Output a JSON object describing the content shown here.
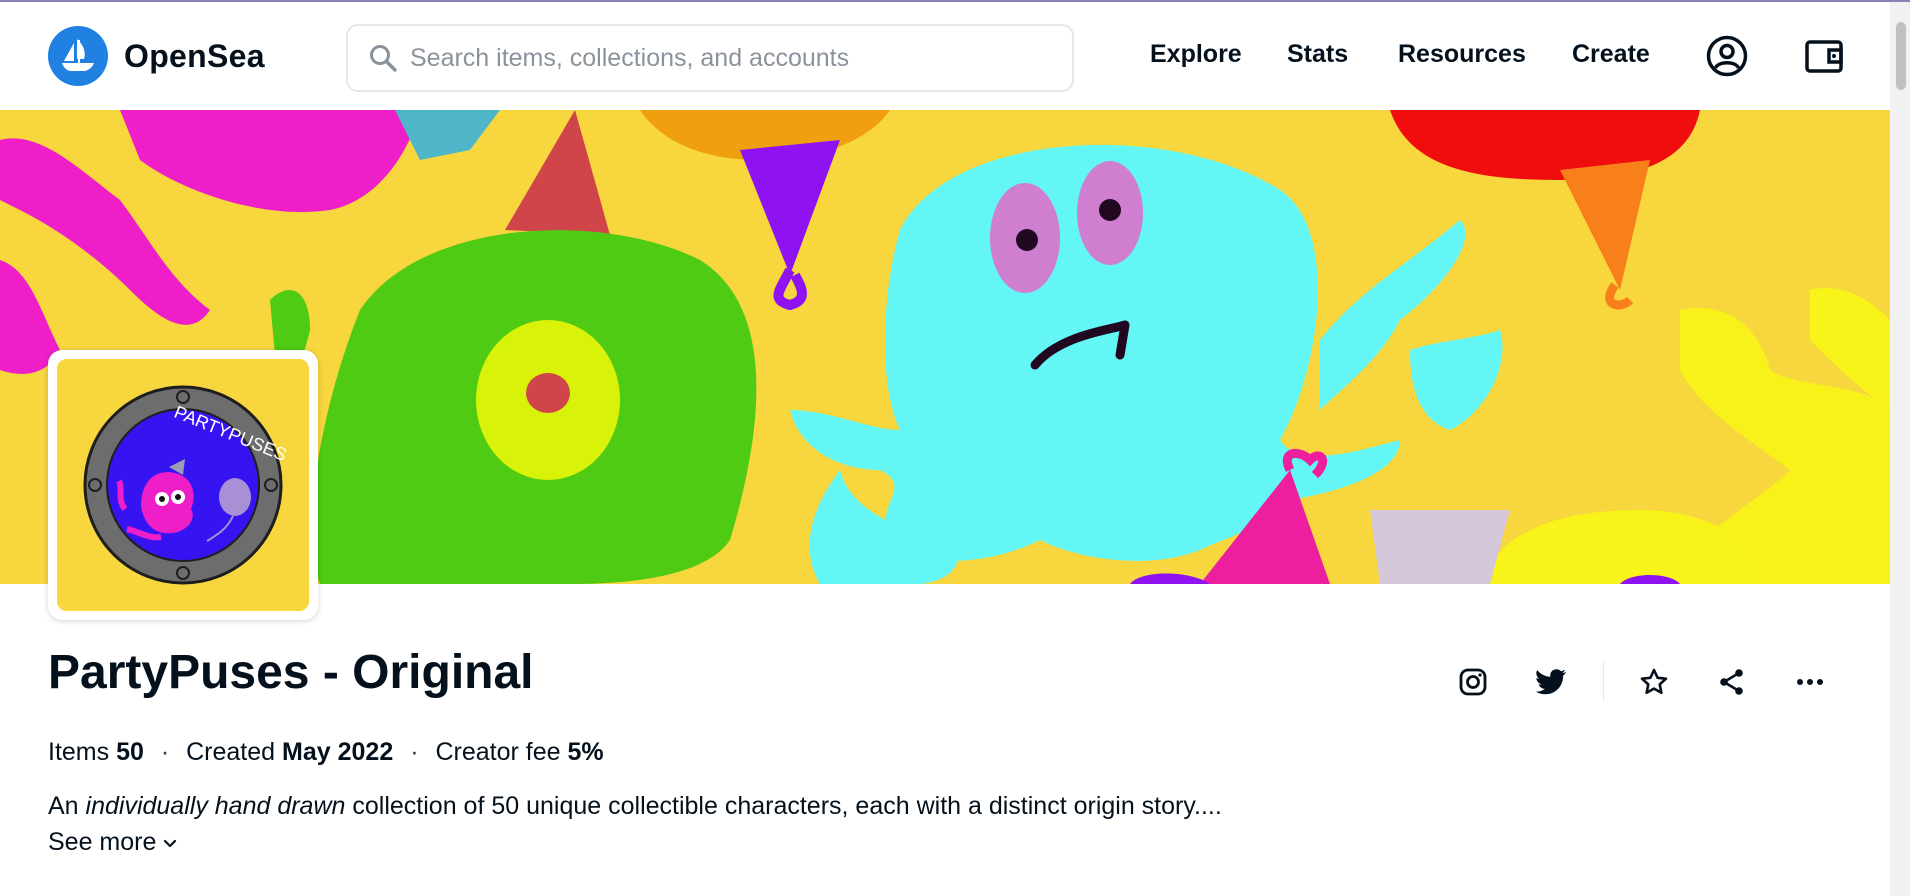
{
  "header": {
    "logo_text": "OpenSea",
    "search_placeholder": "Search items, collections, and accounts",
    "nav": [
      "Explore",
      "Stats",
      "Resources",
      "Create"
    ]
  },
  "icons": {
    "logo": "opensea-boat-icon",
    "search": "search-icon",
    "account": "account-circle-icon",
    "wallet": "wallet-icon",
    "instagram": "instagram-icon",
    "twitter": "twitter-icon",
    "favorite": "star-icon",
    "share": "share-icon",
    "more": "more-horizontal-icon",
    "see_more": "chevron-down-icon"
  },
  "avatar": {
    "badge_text": "PARTYPUSES"
  },
  "collection": {
    "title": "PartyPuses - Original",
    "items_label": "Items",
    "items_value": "50",
    "created_label": "Created",
    "created_value": "May 2022",
    "fee_label": "Creator fee",
    "fee_value": "5%",
    "description_prefix": "An ",
    "description_italic": "individually hand drawn",
    "description_suffix": " collection of 50 unique collectible characters, each with a distinct origin story....",
    "see_more": "See more"
  },
  "colors": {
    "brand": "#2081e2",
    "banner_bg": "#f7d63e",
    "text": "#04111d"
  }
}
